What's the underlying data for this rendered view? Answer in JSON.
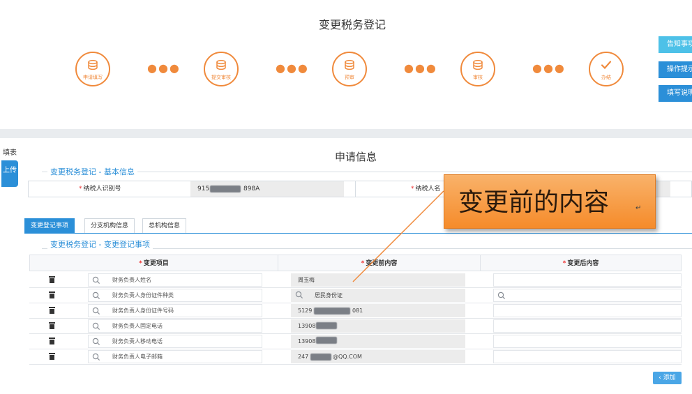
{
  "header": {
    "title": "变更税务登记"
  },
  "steps": [
    {
      "label": "申请填写"
    },
    {
      "label": "提交审核"
    },
    {
      "label": "预审"
    },
    {
      "label": "审核"
    },
    {
      "label": "办结"
    }
  ],
  "side_buttons": [
    {
      "label": "告知事项",
      "color": "#4dc1e8"
    },
    {
      "label": "操作提示",
      "color": "#2b8fd8"
    },
    {
      "label": "填写说明",
      "color": "#2b8fd8"
    }
  ],
  "nav": {
    "fill_label": "填表",
    "upload_label": "上传"
  },
  "section": {
    "title": "申请信息"
  },
  "basic": {
    "subtitle": "变更税务登记 - 基本信息",
    "taxpayer_id_label": "纳税人识别号",
    "taxpayer_id_prefix": "915",
    "taxpayer_id_suffix": "898A",
    "taxpayer_name_label": "纳税人名"
  },
  "tabs": [
    {
      "label": "变更登记事项",
      "active": true
    },
    {
      "label": "分支机构信息",
      "active": false
    },
    {
      "label": "总机构信息",
      "active": false
    }
  ],
  "change": {
    "subtitle": "变更税务登记 - 变更登记事项",
    "columns": [
      "变更项目",
      "变更前内容",
      "变更后内容"
    ],
    "rows": [
      {
        "item": "财务负责人姓名",
        "before": "周玉梅"
      },
      {
        "item": "财务负责人身份证件种类",
        "before": "居民身份证"
      },
      {
        "item": "财务负责人身份证件号码",
        "before_prefix": "5129",
        "before_suffix": "081"
      },
      {
        "item": "财务负责人固定电话",
        "before_prefix": "13908",
        "before_suffix": ""
      },
      {
        "item": "财务负责人移动电话",
        "before_prefix": "13908",
        "before_suffix": ""
      },
      {
        "item": "财务负责人电子邮箱",
        "before_prefix": "247",
        "before_suffix": "@QQ.COM"
      }
    ],
    "add_label": "添加"
  },
  "callout": {
    "text": "变更前的内容",
    "mark": "↵"
  },
  "colors": {
    "accent": "#2b8fd8",
    "step_orange": "#f08a3c",
    "callout": "#f58b2a"
  }
}
